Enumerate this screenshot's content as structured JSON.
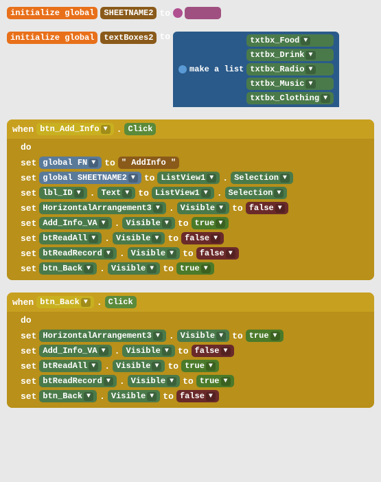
{
  "blocks": {
    "init1": {
      "label": "initialize global",
      "varName": "SHEETNAME2",
      "to": "to",
      "value": ""
    },
    "init2": {
      "label": "initialize global",
      "varName": "textBoxes2",
      "to": "to",
      "makeList": "make a list",
      "items": [
        "txtbx_Food",
        "txtbx_Drink",
        "txtbx_Radio",
        "txtbx_Music",
        "txtbx_Clothing"
      ]
    },
    "event1": {
      "when": "when",
      "component": "btn_Add_Info",
      "event": "Click",
      "do": "do",
      "rows": [
        {
          "set": "set",
          "target": "global FN",
          "dot": ".",
          "prop": "",
          "to": "to",
          "value": "\" AddInfo \""
        },
        {
          "set": "set",
          "target": "global SHEETNAME2",
          "dot": ".",
          "prop": "",
          "to": "to",
          "listView": "ListView1",
          "dotP": ".",
          "selection": "Selection"
        },
        {
          "set": "set",
          "target": "lbl_ID",
          "dot": ".",
          "prop": "Text",
          "to": "to",
          "listView": "ListView1",
          "dotP": ".",
          "selection": "Selection"
        },
        {
          "set": "set",
          "target": "HorizontalArrangement3",
          "dot": ".",
          "prop": "Visible",
          "to": "to",
          "value": "false"
        },
        {
          "set": "set",
          "target": "Add_Info_VA",
          "dot": ".",
          "prop": "Visible",
          "to": "to",
          "value": "true"
        },
        {
          "set": "set",
          "target": "btReadAll",
          "dot": ".",
          "prop": "Visible",
          "to": "to",
          "value": "false"
        },
        {
          "set": "set",
          "target": "btReadRecord",
          "dot": ".",
          "prop": "Visible",
          "to": "to",
          "value": "false"
        },
        {
          "set": "set",
          "target": "btn_Back",
          "dot": ".",
          "prop": "Visible",
          "to": "to",
          "value": "true"
        }
      ]
    },
    "event2": {
      "when": "when",
      "component": "btn_Back",
      "event": "Click",
      "do": "do",
      "rows": [
        {
          "set": "set",
          "target": "HorizontalArrangement3",
          "dot": ".",
          "prop": "Visible",
          "to": "to",
          "value": "true"
        },
        {
          "set": "set",
          "target": "Add_Info_VA",
          "dot": ".",
          "prop": "Visible",
          "to": "to",
          "value": "false"
        },
        {
          "set": "set",
          "target": "btReadAll",
          "dot": ".",
          "prop": "Visible",
          "to": "to",
          "value": "true"
        },
        {
          "set": "set",
          "target": "btReadRecord",
          "dot": ".",
          "prop": "Visible",
          "to": "to",
          "value": "true"
        },
        {
          "set": "set",
          "target": "btn_Back",
          "dot": ".",
          "prop": "Visible",
          "to": "to",
          "value": "false"
        }
      ]
    }
  },
  "colors": {
    "orange": "#e8701a",
    "blue": "#5b80a5",
    "green": "#5ba55b",
    "darkGreen": "#2a6a2a",
    "yellow": "#c8a020",
    "yellowDark": "#b8901a",
    "purple": "#9b59b6",
    "true": "#4a7a2a",
    "false": "#7a2a2a",
    "string": "#a56b1e"
  }
}
